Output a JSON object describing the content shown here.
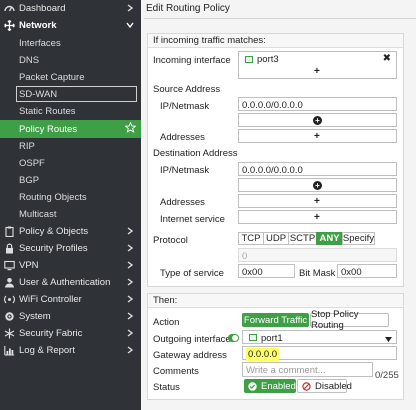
{
  "sidebar": {
    "items": [
      {
        "label": "Dashboard"
      },
      {
        "label": "Network"
      },
      {
        "label": "Interfaces"
      },
      {
        "label": "DNS"
      },
      {
        "label": "Packet Capture"
      },
      {
        "label": "SD-WAN"
      },
      {
        "label": "Static Routes"
      },
      {
        "label": "Policy Routes"
      },
      {
        "label": "RIP"
      },
      {
        "label": "OSPF"
      },
      {
        "label": "BGP"
      },
      {
        "label": "Routing Objects"
      },
      {
        "label": "Multicast"
      },
      {
        "label": "Policy & Objects"
      },
      {
        "label": "Security Profiles"
      },
      {
        "label": "VPN"
      },
      {
        "label": "User & Authentication"
      },
      {
        "label": "WiFi Controller"
      },
      {
        "label": "System"
      },
      {
        "label": "Security Fabric"
      },
      {
        "label": "Log & Report"
      }
    ]
  },
  "dialog": {
    "title": "Edit Routing Policy",
    "match_header": "If incoming traffic matches:",
    "incoming_interface_label": "Incoming interface",
    "incoming_interface_value": "port3",
    "source_address_label": "Source Address",
    "ip_netmask_label": "IP/Netmask",
    "source_ip": "0.0.0.0/0.0.0.0",
    "addresses_label": "Addresses",
    "destination_address_label": "Destination Address",
    "dest_ip": "0.0.0.0/0.0.0.0",
    "internet_service_label": "Internet service",
    "protocol_label": "Protocol",
    "protocol_options": [
      "TCP",
      "UDP",
      "SCTP",
      "ANY",
      "Specify"
    ],
    "protocol_selected": "ANY",
    "protocol_number": "0",
    "type_of_service_label": "Type of service",
    "type_of_service_value": "0x00",
    "bit_mask_label": "Bit Mask",
    "bit_mask_value": "0x00",
    "then_header": "Then:",
    "action_label": "Action",
    "action_forward": "Forward Traffic",
    "action_stop": "Stop Policy Routing",
    "outgoing_interface_label": "Outgoing interface",
    "outgoing_interface_value": "port1",
    "gateway_label": "Gateway address",
    "gateway_value": "0.0.0.0",
    "comments_label": "Comments",
    "comments_placeholder": "Write a comment...",
    "comments_count": "0/255",
    "status_label": "Status",
    "status_enabled": "Enabled",
    "status_disabled": "Disabled"
  },
  "colors": {
    "accent": "#3f9f47",
    "sidebar_bg": "#2f3337",
    "highlight": "#ffff66"
  }
}
